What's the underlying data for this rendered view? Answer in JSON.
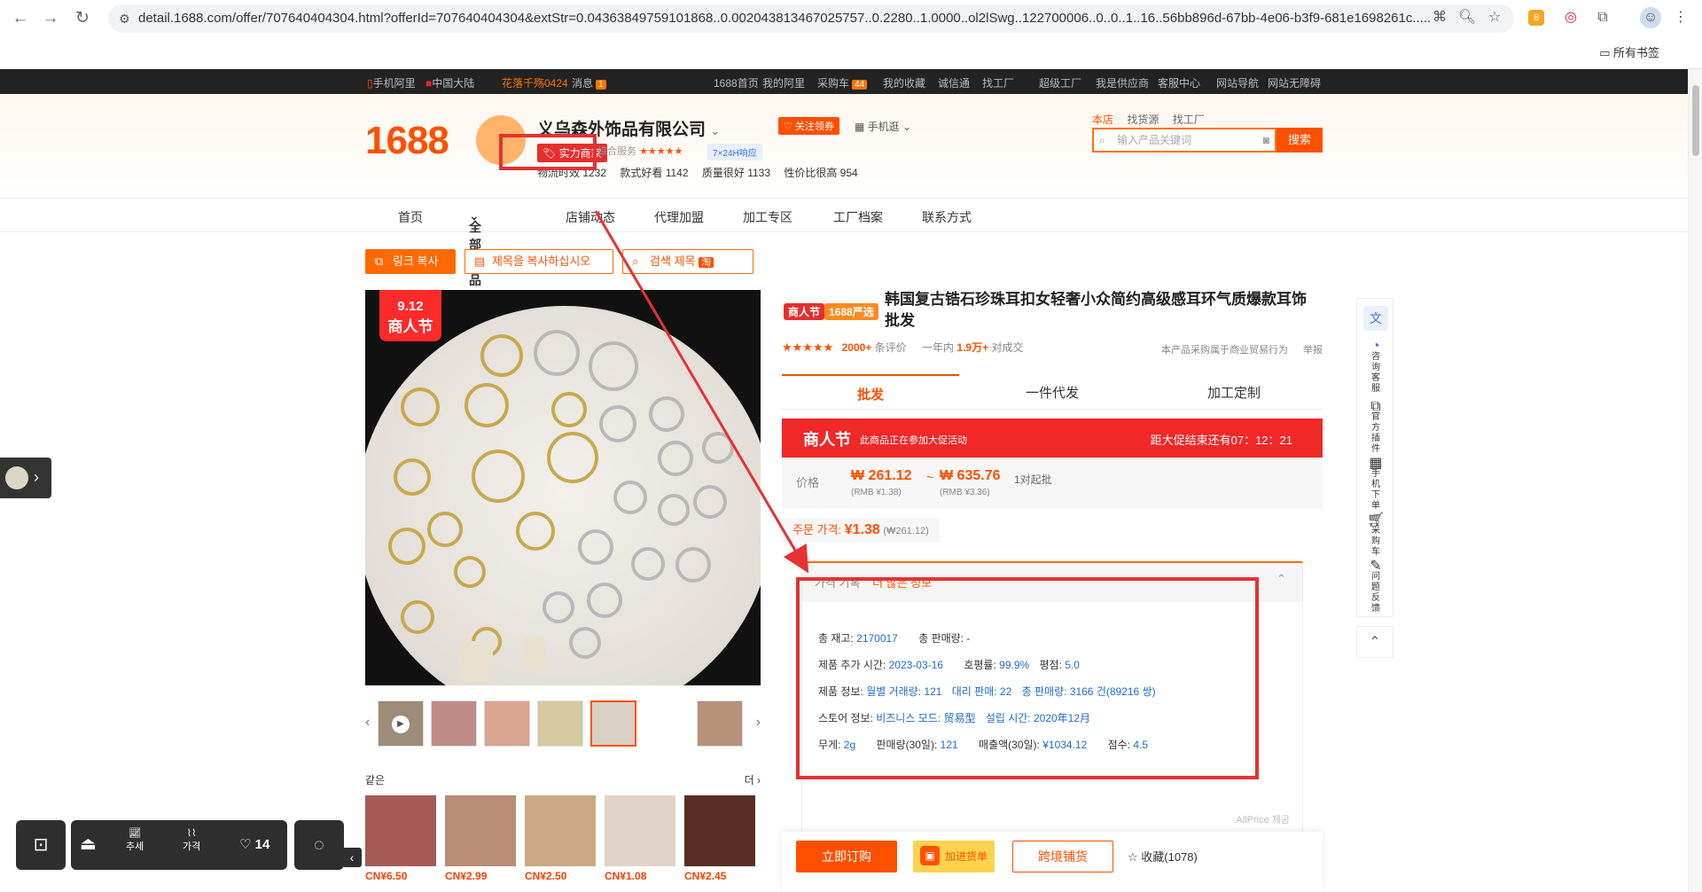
{
  "browser": {
    "url": "detail.1688.com/offer/707640404304.html?offerId=707640404304&extStr=0.04363849759101868..0.002043813467025757..0.2280..1.0000..ol2lSwg..122700006..0..0..1..16..56bb896d-67bb-4e06-b3f9-681e1698261c.....",
    "bookmarks_label": "所有书签"
  },
  "topbar": {
    "items": [
      "手机阿里",
      "中国大陆",
      "花落千殇0424",
      "消息",
      "1688首页",
      "我的阿里",
      "采购车",
      "我的收藏",
      "诚信通",
      "找工厂",
      "超级工厂",
      "我是供应商",
      "客服中心",
      "网站导航",
      "网站无障碍"
    ],
    "msg_count": "1",
    "cart_count": "44"
  },
  "header": {
    "logo": "1688",
    "shop_name": "义乌森外饰品有限公司",
    "shop_tag": "实力商家",
    "service_label": "综合服务",
    "response_label": "7×24H响应",
    "follow_label": "关注领券",
    "mobile_label": "手机逛",
    "search_tabs": [
      "本店",
      "找货源",
      "找工厂"
    ],
    "search_placeholder": "输入产品关键词",
    "search_button": "搜索",
    "stats": [
      "物流时效 1232",
      "款式好看 1142",
      "质量很好 1133",
      "性价比很高 954"
    ]
  },
  "nav": {
    "items": [
      "首页",
      "全部商品",
      "店铺动态",
      "代理加盟",
      "加工专区",
      "工厂档案",
      "联系方式"
    ]
  },
  "actions": {
    "copy_link": "링크 복사",
    "copy_title": "제목을 복사하십시오",
    "search_title": "검색 제목"
  },
  "gallery": {
    "promo_date": "9.12",
    "promo_text": "商人节",
    "similar_label": "같은",
    "more_label": "더",
    "similar_prices": [
      "CN¥6.50",
      "CN¥2.99",
      "CN¥2.50",
      "CN¥1.08",
      "CN¥2.45"
    ]
  },
  "product": {
    "tag1": "商人节",
    "tag2": "1688严选",
    "title": "韩国复古锆石珍珠耳扣女轻奢小众简约高级感耳环气质爆款耳饰批发",
    "reviews": "2000+",
    "reviews_label": "条评价",
    "sold_prefix": "一年内",
    "sold": "1.9万+",
    "sold_suffix": "对成交",
    "trade_note": "本产品采购属于商业贸易行为",
    "report": "举报",
    "tabs": [
      "批发",
      "一件代发",
      "加工定制"
    ],
    "promo_title": "商人节",
    "promo_desc": "此商品正在参加大促活动",
    "countdown": "距大促结束还有07：12：21",
    "price_label": "价格",
    "price_low": "₩ 261.12",
    "price_tilde": "~",
    "price_high": "₩ 635.76",
    "moq": "1对起批",
    "rmb_low": "(RMB ¥1.38)",
    "rmb_high": "(RMB ¥3.36)",
    "order_price_label": "주문 가격:",
    "order_price": "¥1.38",
    "order_price_won": "(₩261.12)"
  },
  "info": {
    "header_left": "가격 기록",
    "header_right": "더 많은 정보",
    "rows": [
      [
        {
          "k": "총 재고:",
          "v": "2170017"
        },
        {
          "k": "총 판매량:",
          "v": "-"
        }
      ],
      [
        {
          "k": "제품 추가 시간:",
          "v": "2023-03-16"
        },
        {
          "k": "호평률:",
          "v": "99.9%"
        },
        {
          "k": "평점:",
          "v": "5.0"
        }
      ],
      [
        {
          "k": "제품 정보:",
          "v": "월별 거래량: 121"
        },
        {
          "k": "",
          "v": "대리 판매: 22"
        },
        {
          "k": "",
          "v": "총 판매량: 3166 건(89216 쌍)"
        }
      ],
      [
        {
          "k": "스토어 정보:",
          "v": "비즈니스 모드: 贸易型"
        },
        {
          "k": "",
          "v": "설립 시간: 2020年12月"
        }
      ],
      [
        {
          "k": "무게:",
          "v": "2g"
        },
        {
          "k": "판매량(30일):",
          "v": "121"
        },
        {
          "k": "매출액(30일):",
          "v": "¥1034.12"
        },
        {
          "k": "점수:",
          "v": "4.5"
        }
      ]
    ],
    "allprice": "AllPrice 제공"
  },
  "order": {
    "buy_now": "立即订购",
    "add_cart": "加进货单",
    "cross_border": "跨境铺货",
    "favorite": "收藏(1078)"
  },
  "sidebar": {
    "items": [
      "咨询客服",
      "官方插件",
      "手机下单",
      "采购车",
      "问题反馈"
    ]
  },
  "bottom_tools": {
    "trend": "추세",
    "price": "가격",
    "likes": "14"
  },
  "colors": {
    "brand": "#ff5000",
    "promo_red": "#f02828",
    "annotation": "#e53232",
    "link_blue": "#1e6ad2"
  }
}
